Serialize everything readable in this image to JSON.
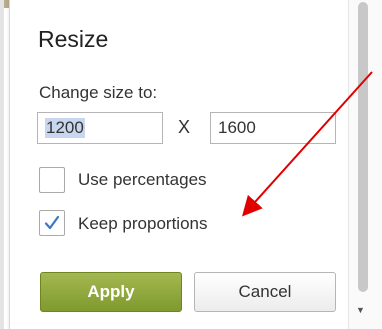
{
  "dialog": {
    "title": "Resize",
    "change_size_label": "Change size to:",
    "width_value": "1200",
    "separator": "X",
    "height_value": "1600",
    "use_percentages_label": "Use percentages",
    "use_percentages_checked": false,
    "keep_proportions_label": "Keep proportions",
    "keep_proportions_checked": true,
    "apply_label": "Apply",
    "cancel_label": "Cancel"
  },
  "colors": {
    "apply_button": "#8aa43a",
    "checkmark": "#3a78c9",
    "annotation_arrow": "#e00000"
  }
}
